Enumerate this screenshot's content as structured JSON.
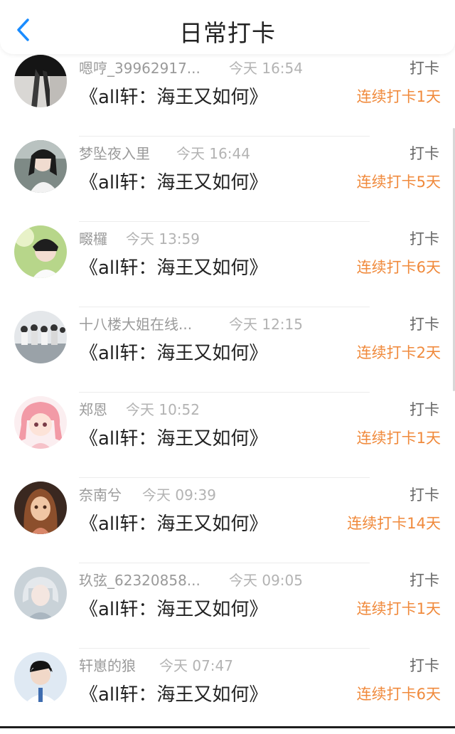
{
  "header": {
    "title": "日常打卡",
    "back_icon": "chevron-left-icon"
  },
  "colors": {
    "accent": "#1a8cff",
    "streak": "#f08a3c"
  },
  "entries": [
    {
      "user": "嗯哼_39962917...",
      "time": "今天 16:54",
      "book": "《all轩：海王又如何》",
      "action": "打卡",
      "streak": "连续打卡1天"
    },
    {
      "user": "梦坠夜入里",
      "time": "今天 16:44",
      "book": "《all轩：海王又如何》",
      "action": "打卡",
      "streak": "连续打卡5天"
    },
    {
      "user": "畷欏",
      "time": "今天 13:59",
      "book": "《all轩：海王又如何》",
      "action": "打卡",
      "streak": "连续打卡6天"
    },
    {
      "user": "十八楼大姐在线...",
      "time": "今天 12:15",
      "book": "《all轩：海王又如何》",
      "action": "打卡",
      "streak": "连续打卡2天"
    },
    {
      "user": "郑恩",
      "time": "今天 10:52",
      "book": "《all轩：海王又如何》",
      "action": "打卡",
      "streak": "连续打卡1天"
    },
    {
      "user": "奈南兮",
      "time": "今天 09:39",
      "book": "《all轩：海王又如何》",
      "action": "打卡",
      "streak": "连续打卡14天"
    },
    {
      "user": "玖弦_62320858...",
      "time": "今天 09:05",
      "book": "《all轩：海王又如何》",
      "action": "打卡",
      "streak": "连续打卡1天"
    },
    {
      "user": "轩崽的狼",
      "time": "今天 07:47",
      "book": "《all轩：海王又如何》",
      "action": "打卡",
      "streak": "连续打卡6天"
    }
  ]
}
